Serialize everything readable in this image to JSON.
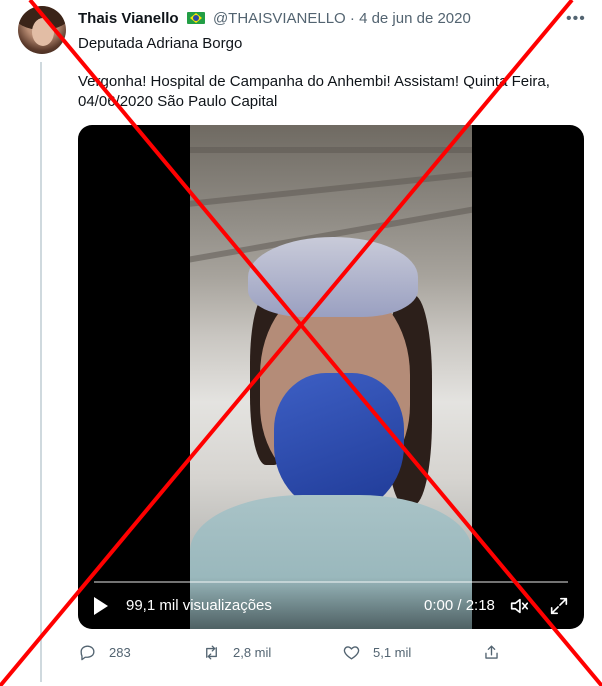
{
  "tweet": {
    "author_name": "Thais Vianello",
    "handle": "@THAISVIANELLO",
    "separator": "·",
    "date": "4 de jun de 2020",
    "more_label": "•••",
    "line1": "Deputada Adriana Borgo",
    "line2": "Vergonha! Hospital de Campanha do Anhembi! Assistam! Quinta Feira, 04/06/2020 São Paulo Capital"
  },
  "video": {
    "views": "99,1 mil visualizações",
    "time": "0:00 / 2:18"
  },
  "actions": {
    "replies": "283",
    "retweets": "2,8 mil",
    "likes": "5,1 mil"
  },
  "icons": {
    "more": "more-icon",
    "play": "play-icon",
    "volume": "volume-muted-icon",
    "expand": "expand-icon",
    "reply": "reply-icon",
    "retweet": "retweet-icon",
    "like": "heart-icon",
    "share": "share-icon",
    "flag": "brazil-flag-icon"
  },
  "colors": {
    "text": "#0f1419",
    "secondary": "#536471",
    "overlay_x": "#ff0000"
  }
}
